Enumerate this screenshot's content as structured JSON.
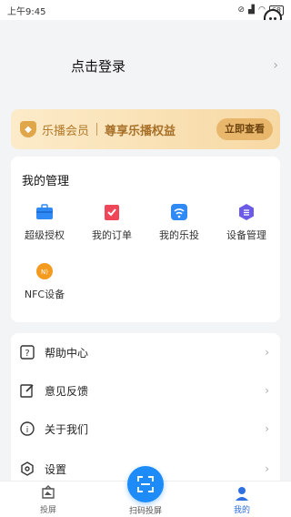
{
  "status_bar": {
    "time": "上午9:45",
    "battery": "68"
  },
  "profile": {
    "login_text": "点击登录"
  },
  "vip_banner": {
    "name": "乐播会员",
    "slogan": "尊享乐播权益",
    "button": "立即查看"
  },
  "management": {
    "title": "我的管理",
    "items": [
      {
        "label": "超级授权",
        "icon": "briefcase-icon"
      },
      {
        "label": "我的订单",
        "icon": "order-icon"
      },
      {
        "label": "我的乐投",
        "icon": "cast-icon"
      },
      {
        "label": "设备管理",
        "icon": "device-icon"
      },
      {
        "label": "NFC设备",
        "icon": "nfc-icon"
      }
    ]
  },
  "menu": {
    "items": [
      {
        "label": "帮助中心",
        "icon": "help-icon"
      },
      {
        "label": "意见反馈",
        "icon": "feedback-icon"
      },
      {
        "label": "关于我们",
        "icon": "info-icon"
      },
      {
        "label": "设置",
        "icon": "settings-icon"
      }
    ]
  },
  "tab_bar": {
    "items": [
      {
        "label": "投屏"
      },
      {
        "label": "扫码投屏"
      },
      {
        "label": "我的"
      }
    ],
    "active_color": "#2f6fe0"
  }
}
